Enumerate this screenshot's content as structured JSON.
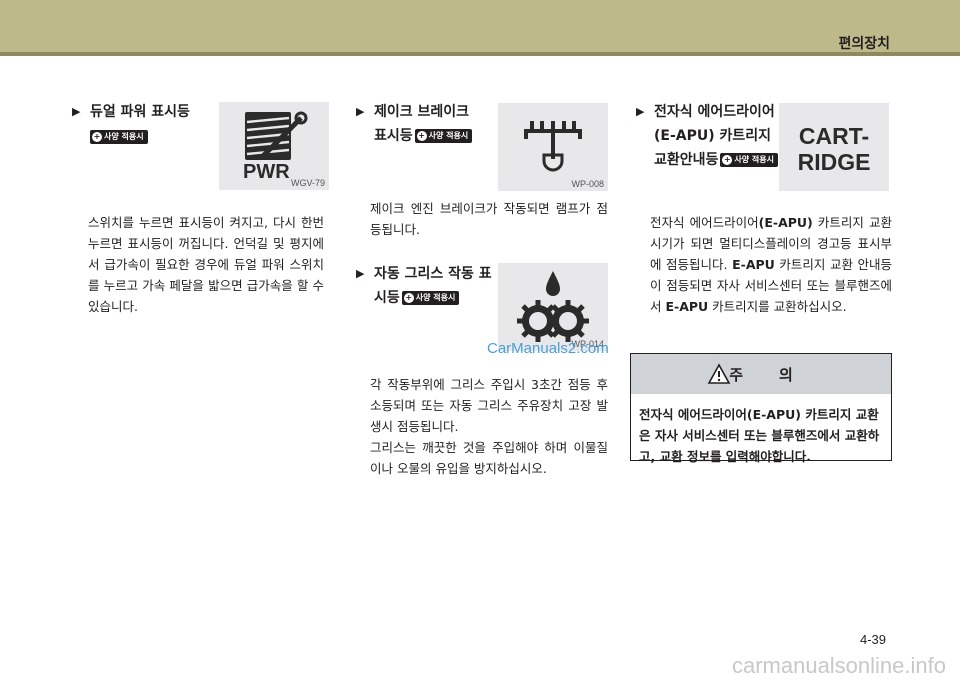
{
  "header": {
    "section": "편의장치"
  },
  "col1": {
    "heading": "듀얼 파워 표시등",
    "badge": "사양 적용시",
    "figure": {
      "label": "PWR",
      "code": "WGV-79"
    },
    "body": "스위치를 누르면 표시등이 켜지고, 다시 한번 누르면 표시등이 꺼집니다. 언덕길 및 평지에서 급가속이 필요한 경우에 듀얼 파워 스위치를 누르고 가속 페달을 밟으면 급가속을 할 수 있습니다."
  },
  "col2": {
    "item1": {
      "heading_l1": "제이크 브레이크",
      "heading_l2": "표시등",
      "badge": "사양 적용시",
      "figure": {
        "code": "WP-008"
      },
      "body": "제이크 엔진 브레이크가 작동되면 램프가 점등됩니다."
    },
    "item2": {
      "heading_l1": "자동 그리스 작동 표",
      "heading_l2": "시등",
      "badge": "사양 적용시",
      "figure": {
        "code": "WP-014"
      },
      "body1": "각 작동부위에 그리스 주입시 3초간 점등 후 소등되며 또는 자동 그리스 주유장치 고장 발생시 점등됩니다.",
      "body2": "그리스는 깨끗한 것을 주입해야 하며 이물질이나 오물의 유입을 방지하십시오."
    }
  },
  "col3": {
    "heading_l1": "전자식 에어드라이어",
    "heading_l2": "(E-APU) 카트리지",
    "heading_l3": "교환안내등",
    "badge": "사양 적용시",
    "figure": {
      "line1": "CART-",
      "line2": "RIDGE"
    },
    "body_a": "전자식 에어드라이어",
    "body_b": "(E-APU)",
    "body_c": " 카트리지 교환 시기가 되면 멀티디스플레이의 경고등 표시부에 점등됩니다. ",
    "body_d": "E-APU",
    "body_e": " 카트리지 교환 안내등이 점등되면 자사 서비스센터 또는 블루핸즈에서 ",
    "body_f": "E-APU",
    "body_g": " 카트리지를 교환하십시오."
  },
  "caution": {
    "title": "주의",
    "body": "전자식 에어드라이어(E-APU) 카트리지 교환은 자사 서비스센터 또는 블루핸즈에서 교환하고, 교환 정보를 입력해야합니다."
  },
  "watermark": "CarManuals2.com",
  "page_number": "4-39",
  "footer_watermark": "carmanualsonline.info"
}
